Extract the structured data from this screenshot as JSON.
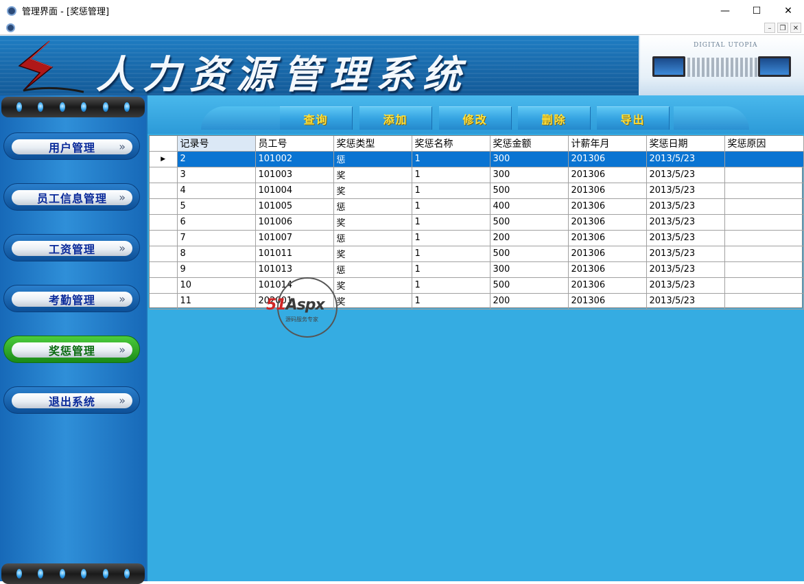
{
  "window": {
    "title": "管理界面 - [奖惩管理]",
    "min_glyph": "—",
    "max_glyph": "☐",
    "close_glyph": "✕"
  },
  "mdi": {
    "min_glyph": "–",
    "restore_glyph": "❐",
    "close_glyph": "✕"
  },
  "banner": {
    "title": "人力资源管理系统",
    "image_caption": "DIGITAL UTOPIA"
  },
  "sidebar": {
    "items": [
      {
        "label": "用户管理",
        "active": false
      },
      {
        "label": "员工信息管理",
        "active": false
      },
      {
        "label": "工资管理",
        "active": false
      },
      {
        "label": "考勤管理",
        "active": false
      },
      {
        "label": "奖惩管理",
        "active": true
      },
      {
        "label": "退出系统",
        "active": false
      }
    ],
    "chevron": "»"
  },
  "toolbar": {
    "query": "查询",
    "add": "添加",
    "edit": "修改",
    "delete": "删除",
    "export": "导出"
  },
  "grid": {
    "columns": [
      "记录号",
      "员工号",
      "奖惩类型",
      "奖惩名称",
      "奖惩金额",
      "计薪年月",
      "奖惩日期",
      "奖惩原因"
    ],
    "current_row_marker": "▶",
    "rows": [
      [
        "2",
        "101002",
        "惩",
        "1",
        "300",
        "201306",
        "2013/5/23",
        ""
      ],
      [
        "3",
        "101003",
        "奖",
        "1",
        "300",
        "201306",
        "2013/5/23",
        ""
      ],
      [
        "4",
        "101004",
        "奖",
        "1",
        "500",
        "201306",
        "2013/5/23",
        ""
      ],
      [
        "5",
        "101005",
        "惩",
        "1",
        "400",
        "201306",
        "2013/5/23",
        ""
      ],
      [
        "6",
        "101006",
        "奖",
        "1",
        "500",
        "201306",
        "2013/5/23",
        ""
      ],
      [
        "7",
        "101007",
        "惩",
        "1",
        "200",
        "201306",
        "2013/5/23",
        ""
      ],
      [
        "8",
        "101011",
        "奖",
        "1",
        "500",
        "201306",
        "2013/5/23",
        ""
      ],
      [
        "9",
        "101013",
        "惩",
        "1",
        "300",
        "201306",
        "2013/5/23",
        ""
      ],
      [
        "10",
        "101014",
        "奖",
        "1",
        "500",
        "201306",
        "2013/5/23",
        ""
      ],
      [
        "11",
        "202001",
        "奖",
        "1",
        "200",
        "201306",
        "2013/5/23",
        ""
      ]
    ]
  },
  "watermark": {
    "brand_red": "51",
    "brand_dark": "Aspx",
    "tagline": "源码服务专家"
  },
  "colors": {
    "selection": "#0a74d2",
    "toolbar_text": "#ffe23c",
    "main_bg": "#35ace2",
    "nav_text": "#0a2a9a",
    "active_nav": "#2aa828"
  }
}
